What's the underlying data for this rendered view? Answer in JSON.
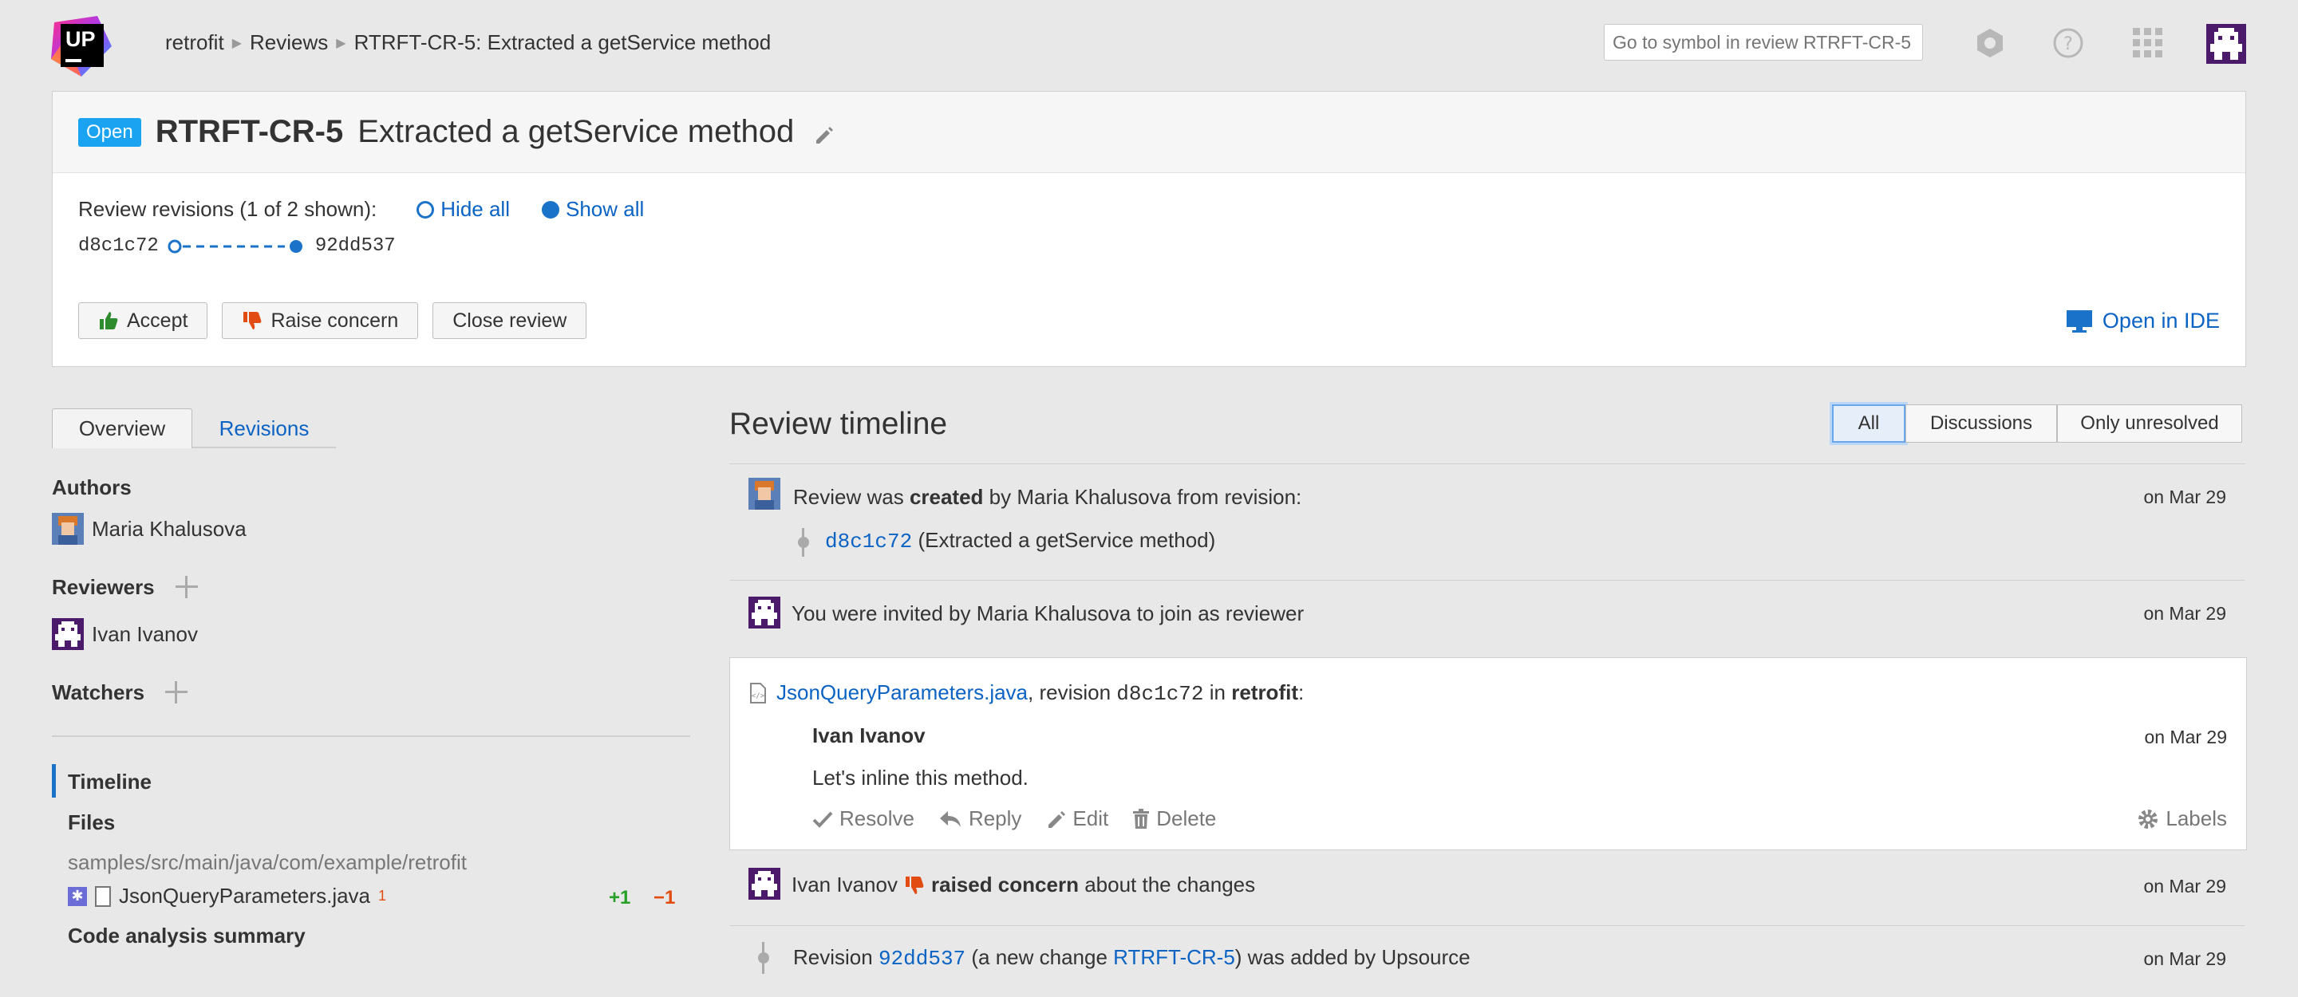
{
  "header": {
    "breadcrumb": [
      "retrofit",
      "Reviews",
      "RTRFT-CR-5: Extracted a getService method"
    ],
    "search_placeholder": "Go to symbol in review RTRFT-CR-5",
    "logo_text": "UP"
  },
  "review": {
    "status": "Open",
    "id": "RTRFT-CR-5",
    "title": "Extracted a getService method",
    "revisions_label": "Review revisions (1 of 2 shown):",
    "hide_all": "Hide all",
    "show_all": "Show all",
    "rev_from": "d8c1c72",
    "rev_to": "92dd537",
    "accept": "Accept",
    "raise_concern": "Raise concern",
    "close_review": "Close review",
    "open_ide": "Open in IDE"
  },
  "left": {
    "tab_overview": "Overview",
    "tab_revisions": "Revisions",
    "authors_label": "Authors",
    "author": "Maria Khalusova",
    "reviewers_label": "Reviewers",
    "reviewer": "Ivan Ivanov",
    "watchers_label": "Watchers",
    "nav_timeline": "Timeline",
    "nav_files": "Files",
    "file_path": "samples/src/main/java/com/example/retrofit",
    "file_name": "JsonQueryParameters.java",
    "file_comments": "1",
    "added": "+1",
    "removed": "−1",
    "nav_code_analysis": "Code analysis summary"
  },
  "timeline": {
    "title": "Review timeline",
    "filters": [
      "All",
      "Discussions",
      "Only unresolved"
    ],
    "e1_pre": "Review was ",
    "e1_bold": "created",
    "e1_post": " by Maria Khalusova from revision:",
    "e1_rev": "d8c1c72",
    "e1_rev_msg": " (Extracted a getService method)",
    "e1_date": "on Mar 29",
    "e2_text": "You were invited by Maria Khalusova to join as reviewer",
    "e2_date": "on Mar 29",
    "c_file": "JsonQueryParameters.java",
    "c_rev_pre": ", revision ",
    "c_rev": "d8c1c72",
    "c_in": " in ",
    "c_project": "retrofit",
    "c_colon": ":",
    "c_author": "Ivan Ivanov",
    "c_date": "on Mar 29",
    "c_body": "Let's inline this method.",
    "c_resolve": "Resolve",
    "c_reply": "Reply",
    "c_edit": "Edit",
    "c_delete": "Delete",
    "c_labels": "Labels",
    "e3_name": "Ivan Ivanov",
    "e3_bold": "raised concern",
    "e3_post": " about the changes",
    "e3_date": "on Mar 29",
    "e4_pre": "Revision ",
    "e4_rev": "92dd537",
    "e4_mid": " (a new change ",
    "e4_link": "RTRFT-CR-5",
    "e4_post": ") was added by Upsource",
    "e4_date": "on Mar 29"
  },
  "colors": {
    "accent": "#0b63c4",
    "open_badge": "#1aa3f0",
    "added": "#27a027",
    "removed": "#e24b12",
    "concern": "#e24b12",
    "accept": "#2e8b2e"
  }
}
